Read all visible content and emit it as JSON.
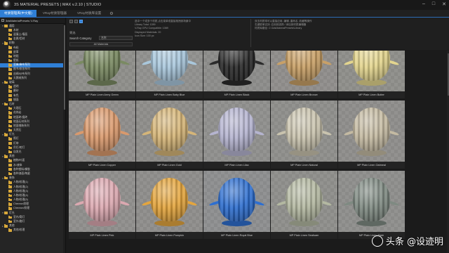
{
  "app": {
    "title": "3S MATERIAL PRESETS | MAX v.2.10 | STUDIO"
  },
  "tabs": [
    {
      "label": "材质管理库(中文版)",
      "active": true
    },
    {
      "label": "VRay材质管理器",
      "active": false
    },
    {
      "label": "VRay材质库设置",
      "active": false
    }
  ],
  "tree": {
    "root_label": "3dsMaterialPresets V-Ray",
    "items": [
      {
        "label": "通用",
        "level": 0,
        "expanded": true
      },
      {
        "label": "木材",
        "level": 1
      },
      {
        "label": "混凝土/墙面",
        "level": 1
      },
      {
        "label": "金属/铝材",
        "level": 1
      },
      {
        "label": "织物",
        "level": 0,
        "expanded": true
      },
      {
        "label": "布料",
        "level": 1
      },
      {
        "label": "皮革",
        "level": 1
      },
      {
        "label": "地毯",
        "level": 1
      },
      {
        "label": "壁纸",
        "level": 1
      },
      {
        "label": "亚麻/麻布系列",
        "level": 1,
        "selected": true
      },
      {
        "label": "图书/纸张系列",
        "level": 1
      },
      {
        "label": "丝绸/纱布系列",
        "level": 1
      },
      {
        "label": "天鹅绒系列",
        "level": 1
      },
      {
        "label": "玻璃",
        "level": 0,
        "expanded": true
      },
      {
        "label": "透明",
        "level": 1
      },
      {
        "label": "磨砂",
        "level": 1
      },
      {
        "label": "有色",
        "level": 1
      },
      {
        "label": "镜面",
        "level": 1
      },
      {
        "label": "石材",
        "level": 0,
        "expanded": true
      },
      {
        "label": "大理石",
        "level": 1
      },
      {
        "label": "花岗岩",
        "level": 1
      },
      {
        "label": "地面砖/瓷砖",
        "level": 1
      },
      {
        "label": "地面石材系列",
        "level": 1
      },
      {
        "label": "地面铺装系列",
        "level": 1
      },
      {
        "label": "天然石",
        "level": 1
      },
      {
        "label": "灯光",
        "level": 0,
        "expanded": true
      },
      {
        "label": "筒灯",
        "level": 1
      },
      {
        "label": "灯带",
        "level": 1
      },
      {
        "label": "吊灯/射灯",
        "level": 1
      },
      {
        "label": "自发光",
        "level": 1
      },
      {
        "label": "其他",
        "level": 0,
        "expanded": true
      },
      {
        "label": "植物/叶面",
        "level": 1
      },
      {
        "label": "水/液体",
        "level": 1
      },
      {
        "label": "各种塑料/橡胶",
        "level": 1
      },
      {
        "label": "各种漆面/陶瓷",
        "level": 1
      },
      {
        "label": "装饰",
        "level": 0,
        "expanded": true
      },
      {
        "label": "人物/纹理(1)",
        "level": 1
      },
      {
        "label": "人物/纹理(2)",
        "level": 1
      },
      {
        "label": "人物/纹理(3)",
        "level": 1
      },
      {
        "label": "人物/纹理(4)",
        "level": 1
      },
      {
        "label": "人物/纹理(5)",
        "level": 1
      },
      {
        "label": "Chevron纹理",
        "level": 1
      },
      {
        "label": "Chevron/纹理",
        "level": 1
      },
      {
        "label": "灯光",
        "level": 0,
        "expanded": true
      },
      {
        "label": "室内/筒灯",
        "level": 1
      },
      {
        "label": "室外/路灯",
        "level": 1
      },
      {
        "label": "其他",
        "level": 0
      },
      {
        "label": "其他/纹理",
        "level": 1
      }
    ]
  },
  "toolbar": {
    "filter_label": "筛选",
    "search_category_label": "Search Category",
    "search_value": "名称",
    "filter_value": "All Materials"
  },
  "info": {
    "col1": [
      "选中一个或多个材质,点击菜单或直接拖拽到场景中",
      "Library Total: 1289",
      "V-Ray GPU Compatible: 1089",
      "Displayed Materials: 20",
      "",
      "Icon Size: 100 px"
    ],
    "col2": [
      "双击材质球可以直接应用, 编辑, 重命名, 收藏等操作",
      "右键菜单支持: 应用到选择 / 添加到材质编辑器",
      "材质库路径: C:\\3dsMaterialPresets\\Library"
    ]
  },
  "materials": [
    {
      "name": "MP Plain Linen Army Green",
      "color": "#7a8a62",
      "bg": "#8a8a86"
    },
    {
      "name": "MP Plain Linen Baby Blue",
      "color": "#a9c7dc",
      "bg": "#8c8c8a"
    },
    {
      "name": "MP Plain Linen Black",
      "color": "#2b2b2b",
      "bg": "#888886"
    },
    {
      "name": "MP Plain Linen Bronze",
      "color": "#c8a067",
      "bg": "#8b8987"
    },
    {
      "name": "MP Plain Linen Butter",
      "color": "#e3d58e",
      "bg": "#8a8a86"
    },
    {
      "name": "MP Plain Linen Copper",
      "color": "#d9996c",
      "bg": "#8b8987"
    },
    {
      "name": "MP Plain Linen Gold",
      "color": "#d5b578",
      "bg": "#8a8986"
    },
    {
      "name": "MP Plain Linen Lilac",
      "color": "#b5b4d0",
      "bg": "#8b8b89"
    },
    {
      "name": "MP Plain Linen Natural",
      "color": "#c9c3ae",
      "bg": "#8a8a87"
    },
    {
      "name": "MP Plain Linen Oatmeal",
      "color": "#c4baa2",
      "bg": "#8a8987"
    },
    {
      "name": "MP Plain Linen Pink",
      "color": "#dba8b0",
      "bg": "#8b8a88"
    },
    {
      "name": "MP Plain Linen Pumpkin",
      "color": "#e3a53e",
      "bg": "#8a8987"
    },
    {
      "name": "MP Plain Linen Royal Blue",
      "color": "#2f6fcf",
      "bg": "#898a8b"
    },
    {
      "name": "MP Plain Linen Seafoam",
      "color": "#b3b8a1",
      "bg": "#8a8a87"
    },
    {
      "name": "MP Plain Linen Slate",
      "color": "#7f8a82",
      "bg": "#8a8a88"
    }
  ],
  "watermark": {
    "text": "头条 @设迹明"
  }
}
